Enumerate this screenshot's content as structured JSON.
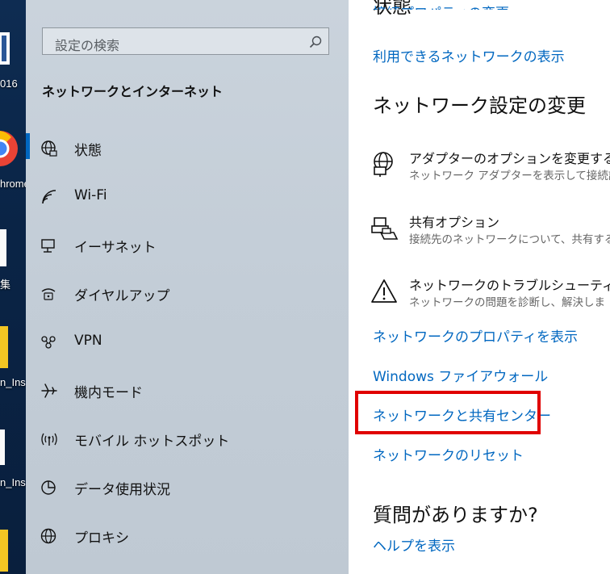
{
  "desktop": {
    "labels": [
      "016",
      "hrome",
      "集",
      "n_Ins",
      "n_Ins"
    ]
  },
  "nav": {
    "search_placeholder": "設定の検索",
    "heading": "ネットワークとインターネット",
    "items": [
      {
        "label": "状態",
        "icon": "globe-icon"
      },
      {
        "label": "Wi-Fi",
        "icon": "wifi-icon"
      },
      {
        "label": "イーサネット",
        "icon": "ethernet-icon"
      },
      {
        "label": "ダイヤルアップ",
        "icon": "dialup-icon"
      },
      {
        "label": "VPN",
        "icon": "vpn-icon"
      },
      {
        "label": "機内モード",
        "icon": "airplane-icon"
      },
      {
        "label": "モバイル ホットスポット",
        "icon": "hotspot-icon"
      },
      {
        "label": "データ使用状況",
        "icon": "data-usage-icon"
      },
      {
        "label": "プロキシ",
        "icon": "proxy-globe-icon"
      }
    ]
  },
  "content": {
    "top_title": "状態",
    "top_link": "接続プロパティの変更",
    "available_networks_link": "利用できるネットワークの表示",
    "section_title": "ネットワーク設定の変更",
    "options": [
      {
        "title": "アダプターのオプションを変更する",
        "desc": "ネットワーク アダプターを表示して接続設",
        "icon": "adapter-icon"
      },
      {
        "title": "共有オプション",
        "desc": "接続先のネットワークについて、共有する",
        "icon": "sharing-icon"
      },
      {
        "title": "ネットワークのトラブルシューティング ツー",
        "desc": "ネットワークの問題を診断し、解決しま",
        "icon": "warning-icon"
      }
    ],
    "links": [
      "ネットワークのプロパティを表示",
      "Windows ファイアウォール",
      "ネットワークと共有センター",
      "ネットワークのリセット"
    ],
    "question_title": "質問がありますか?",
    "help_link": "ヘルプを表示"
  },
  "colors": {
    "accent": "#0067c0",
    "highlight": "#e00000"
  }
}
